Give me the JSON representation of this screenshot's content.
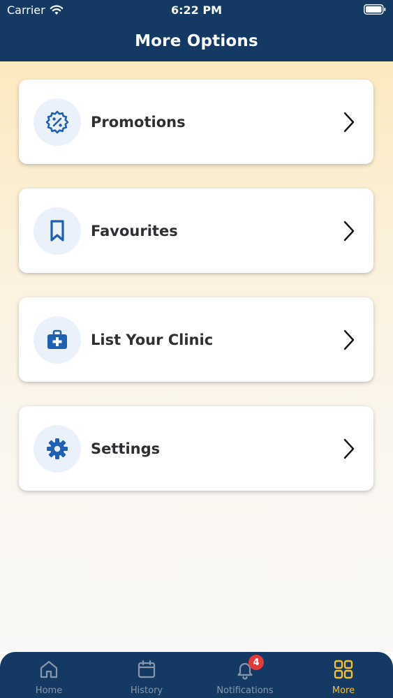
{
  "status_bar": {
    "carrier": "Carrier",
    "time": "6:22 PM"
  },
  "header": {
    "title": "More Options"
  },
  "menu": {
    "items": [
      {
        "label": "Promotions",
        "icon": "discount-badge-icon"
      },
      {
        "label": "Favourites",
        "icon": "bookmark-icon"
      },
      {
        "label": "List Your Clinic",
        "icon": "medical-kit-icon"
      },
      {
        "label": "Settings",
        "icon": "gear-icon"
      }
    ]
  },
  "tabbar": {
    "tabs": [
      {
        "label": "Home",
        "icon": "home-icon"
      },
      {
        "label": "History",
        "icon": "calendar-icon"
      },
      {
        "label": "Notifications",
        "icon": "bell-icon",
        "badge": "4"
      },
      {
        "label": "More",
        "icon": "grid-icon",
        "active": true
      }
    ]
  },
  "colors": {
    "primary": "#143a64",
    "accent": "#f4c02f",
    "icon_blue": "#1f5fb4",
    "badge_red": "#e53a3a"
  }
}
